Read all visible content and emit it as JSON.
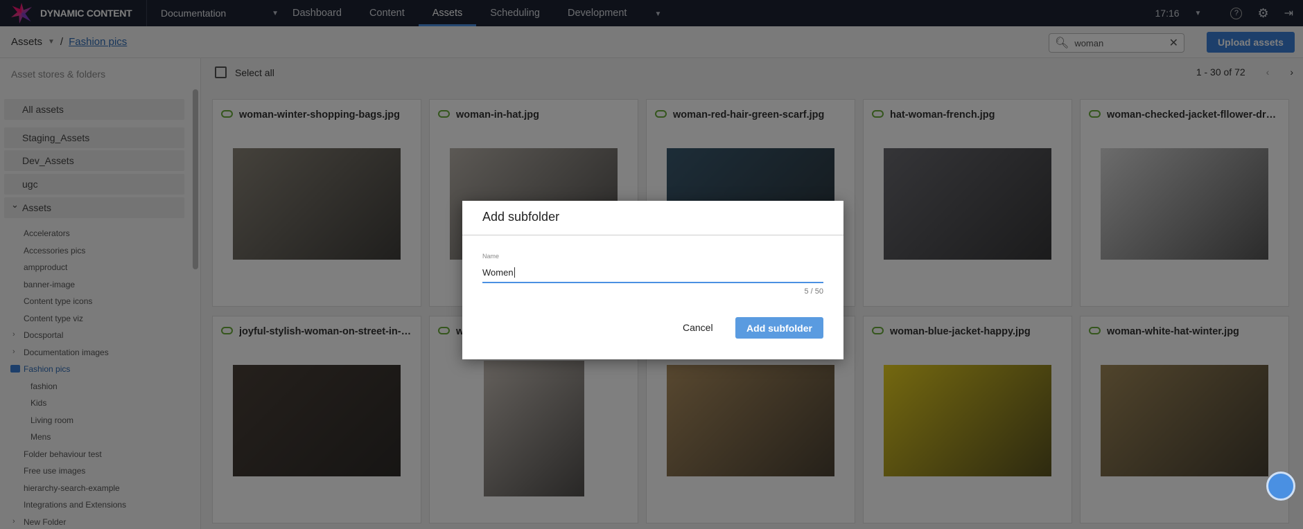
{
  "app": {
    "name": "DYNAMIC CONTENT",
    "workspace": "Documentation",
    "time": "17:16"
  },
  "nav": [
    "Dashboard",
    "Content",
    "Assets",
    "Scheduling",
    "Development"
  ],
  "nav_active": "Assets",
  "breadcrumb": {
    "root": "Assets",
    "current": "Fashion pics"
  },
  "search": {
    "value": "woman"
  },
  "upload_label": "Upload assets",
  "sidebar": {
    "title": "Asset stores & folders",
    "stores": [
      "All assets",
      "Staging_Assets",
      "Dev_Assets",
      "ugc",
      "Assets"
    ],
    "folders": [
      {
        "label": "Accelerators"
      },
      {
        "label": "Accessories pics"
      },
      {
        "label": "ampproduct"
      },
      {
        "label": "banner-image"
      },
      {
        "label": "Content type icons"
      },
      {
        "label": "Content type viz"
      },
      {
        "label": "Docsportal",
        "expandable": true
      },
      {
        "label": "Documentation images",
        "expandable": true
      },
      {
        "label": "Fashion pics",
        "selected": true
      },
      {
        "label": "fashion",
        "sub": true
      },
      {
        "label": "Kids",
        "sub": true
      },
      {
        "label": "Living room",
        "sub": true
      },
      {
        "label": "Mens",
        "sub": true
      },
      {
        "label": "Folder behaviour test"
      },
      {
        "label": "Free use images"
      },
      {
        "label": "hierarchy-search-example"
      },
      {
        "label": "Integrations and Extensions"
      },
      {
        "label": "New Folder",
        "expandable": true
      }
    ]
  },
  "toolbar": {
    "select_all": "Select all",
    "pagination": "1 - 30 of 72"
  },
  "cards": [
    {
      "title": "woman-winter-shopping-bags.jpg",
      "color": "#8a8478"
    },
    {
      "title": "woman-in-hat.jpg",
      "color": "#b8b2aa"
    },
    {
      "title": "woman-red-hair-green-scarf.jpg",
      "color": "#3a5a70"
    },
    {
      "title": "hat-woman-french.jpg",
      "color": "#6a6a70"
    },
    {
      "title": "woman-checked-jacket-fllower-dress.jpg",
      "color": "#d8d8d8"
    },
    {
      "title": "joyful-stylish-woman-on-street-in-city.jpg",
      "color": "#4a4038"
    },
    {
      "title": "woma",
      "color": "#c8c0b8"
    },
    {
      "title": "",
      "color": "#b09060"
    },
    {
      "title": "woman-blue-jacket-happy.jpg",
      "color": "#e8d020"
    },
    {
      "title": "woman-white-hat-winter.jpg",
      "color": "#a08858"
    }
  ],
  "dialog": {
    "title": "Add subfolder",
    "field_label": "Name",
    "value": "Women",
    "counter": "5 / 50",
    "cancel": "Cancel",
    "confirm": "Add subfolder"
  },
  "colors": {
    "header": "#1c2333",
    "accent": "#4a90e2",
    "cloud": "#6aad3b"
  }
}
